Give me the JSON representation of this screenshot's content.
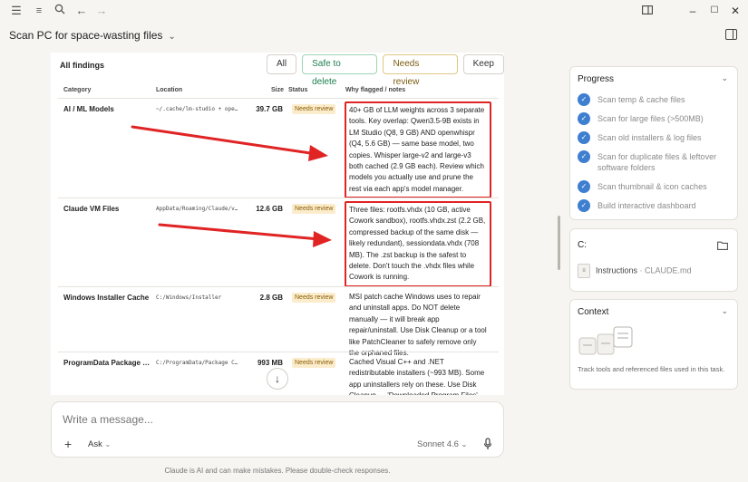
{
  "chat": {
    "title": "Scan PC for space-wasting files"
  },
  "findings": {
    "heading": "All findings",
    "filters": [
      "All",
      "Safe to delete",
      "Needs review",
      "Keep"
    ],
    "columns": [
      "Category",
      "Location",
      "Size",
      "Status",
      "Why flagged / notes"
    ],
    "rows": [
      {
        "category": "AI / ML Models",
        "location": "~/.cache/lm-studio + ope…",
        "size": "39.7 GB",
        "status": "Needs review",
        "notes": "40+ GB of LLM weights across 3 separate tools. Key overlap: Qwen3.5-9B exists in LM Studio (Q8, 9 GB) AND openwhispr (Q4, 5.6 GB) — same base model, two copies. Whisper large-v2 and large-v3 both cached (2.9 GB each). Review which models you actually use and prune the rest via each app's model manager."
      },
      {
        "category": "Claude VM Files",
        "location": "AppData/Roaming/Claude/v…",
        "size": "12.6 GB",
        "status": "Needs review",
        "notes": "Three files: rootfs.vhdx (10 GB, active Cowork sandbox), rootfs.vhdx.zst (2.2 GB, compressed backup of the same disk — likely redundant), sessiondata.vhdx (708 MB). The .zst backup is the safest to delete. Don't touch the .vhdx files while Cowork is running."
      },
      {
        "category": "Windows Installer Cache",
        "location": "C:/Windows/Installer",
        "size": "2.8 GB",
        "status": "Needs review",
        "notes": "MSI patch cache Windows uses to repair and uninstall apps. Do NOT delete manually — it will break app repair/uninstall. Use Disk Cleanup or a tool like PatchCleaner to safely remove only the orphaned files."
      },
      {
        "category": "ProgramData Package …",
        "location": "C:/ProgramData/Package C…",
        "size": "993 MB",
        "status": "Needs review",
        "notes": "Cached Visual C++ and .NET redistributable installers (~993 MB). Some app uninstallers rely on these. Use Disk Cleanup → 'Downloaded Program Files'"
      }
    ]
  },
  "composer": {
    "placeholder": "Write a message...",
    "mode": "Ask",
    "model": "Sonnet 4.6"
  },
  "disclaimer": "Claude is AI and can make mistakes. Please double-check responses.",
  "progress": {
    "title": "Progress",
    "steps": [
      "Scan temp & cache files",
      "Scan for large files (>500MB)",
      "Scan old installers & log files",
      "Scan for duplicate files & leftover software folders",
      "Scan thumbnail & icon caches",
      "Build interactive dashboard"
    ]
  },
  "drive": {
    "title": "C:",
    "file_name": "Instructions",
    "file_sep": " · ",
    "file_ref": "CLAUDE.md"
  },
  "context": {
    "title": "Context",
    "description": "Track tools and referenced files used in this task."
  },
  "colors": {
    "accent": "#3f7fd0",
    "highlight": "#e02424",
    "badge_bg": "#fbeccc",
    "badge_fg": "#8a5b00"
  }
}
